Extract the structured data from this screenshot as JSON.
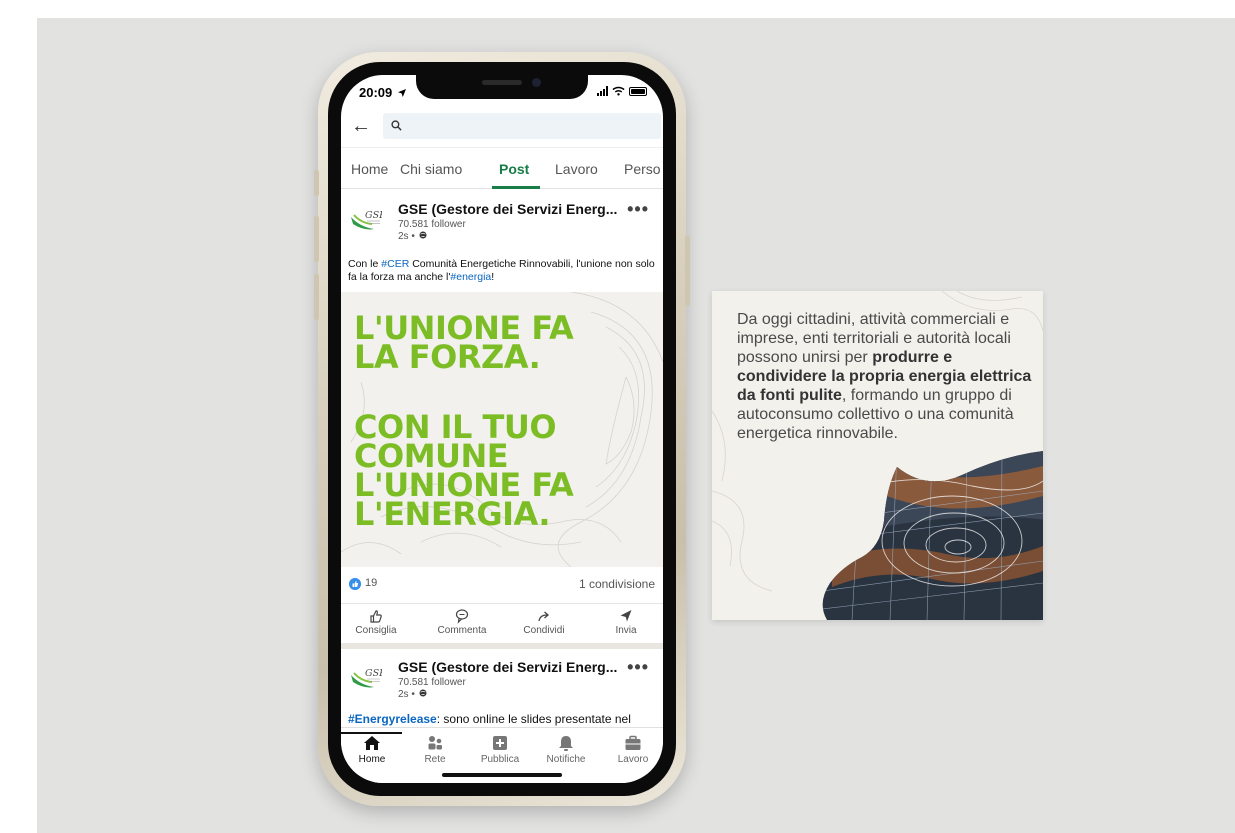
{
  "status_bar": {
    "time": "20:09"
  },
  "search": {
    "placeholder": ""
  },
  "tabs": [
    {
      "label": "Home"
    },
    {
      "label": "Chi siamo"
    },
    {
      "label": "Post"
    },
    {
      "label": "Lavoro"
    },
    {
      "label": "Perso"
    }
  ],
  "post1": {
    "logo_text": "GSE",
    "org_name": "GSE (Gestore dei Servizi Energ...",
    "followers": "70.581 follower",
    "time": "2s •",
    "text_1": "Con le ",
    "tag_1": "#CER",
    "text_2": " Comunità Energetiche Rinnovabili, l'unione non solo fa la forza ma anche l'",
    "tag_2": "#energia",
    "text_3": "!",
    "headline_lines": [
      "L'UNIONE FA",
      "LA FORZA.",
      "CON IL TUO",
      "COMUNE",
      "L'UNIONE FA",
      "L'ENERGIA."
    ],
    "likes": "19",
    "shares": "1 condivisione",
    "actions": [
      "Consiglia",
      "Commenta",
      "Condividi",
      "Invia"
    ]
  },
  "post2": {
    "logo_text": "GSE",
    "org_name": "GSE (Gestore dei Servizi Energ...",
    "followers": "70.581 follower",
    "time": "2s •",
    "tag": "#Energyrelease",
    "text": ": sono online le slides presentate nel"
  },
  "bottom_nav": [
    "Home",
    "Rete",
    "Pubblica",
    "Notifiche",
    "Lavoro"
  ],
  "card": {
    "text_1": "Da oggi cittadini, attività commerciali e imprese, enti territoriali e autorità locali possono unirsi per ",
    "text_bold": "produrre e condividere la propria energia elettrica da fonti pulite",
    "text_2": ", formando un gruppo di autoconsumo collettivo o una comunità energetica rinnovabile."
  },
  "colors": {
    "brand_green": "#7cbd26",
    "active_tab": "#187d46",
    "link_blue": "#0a66c2",
    "like_blue": "#378fe9"
  }
}
